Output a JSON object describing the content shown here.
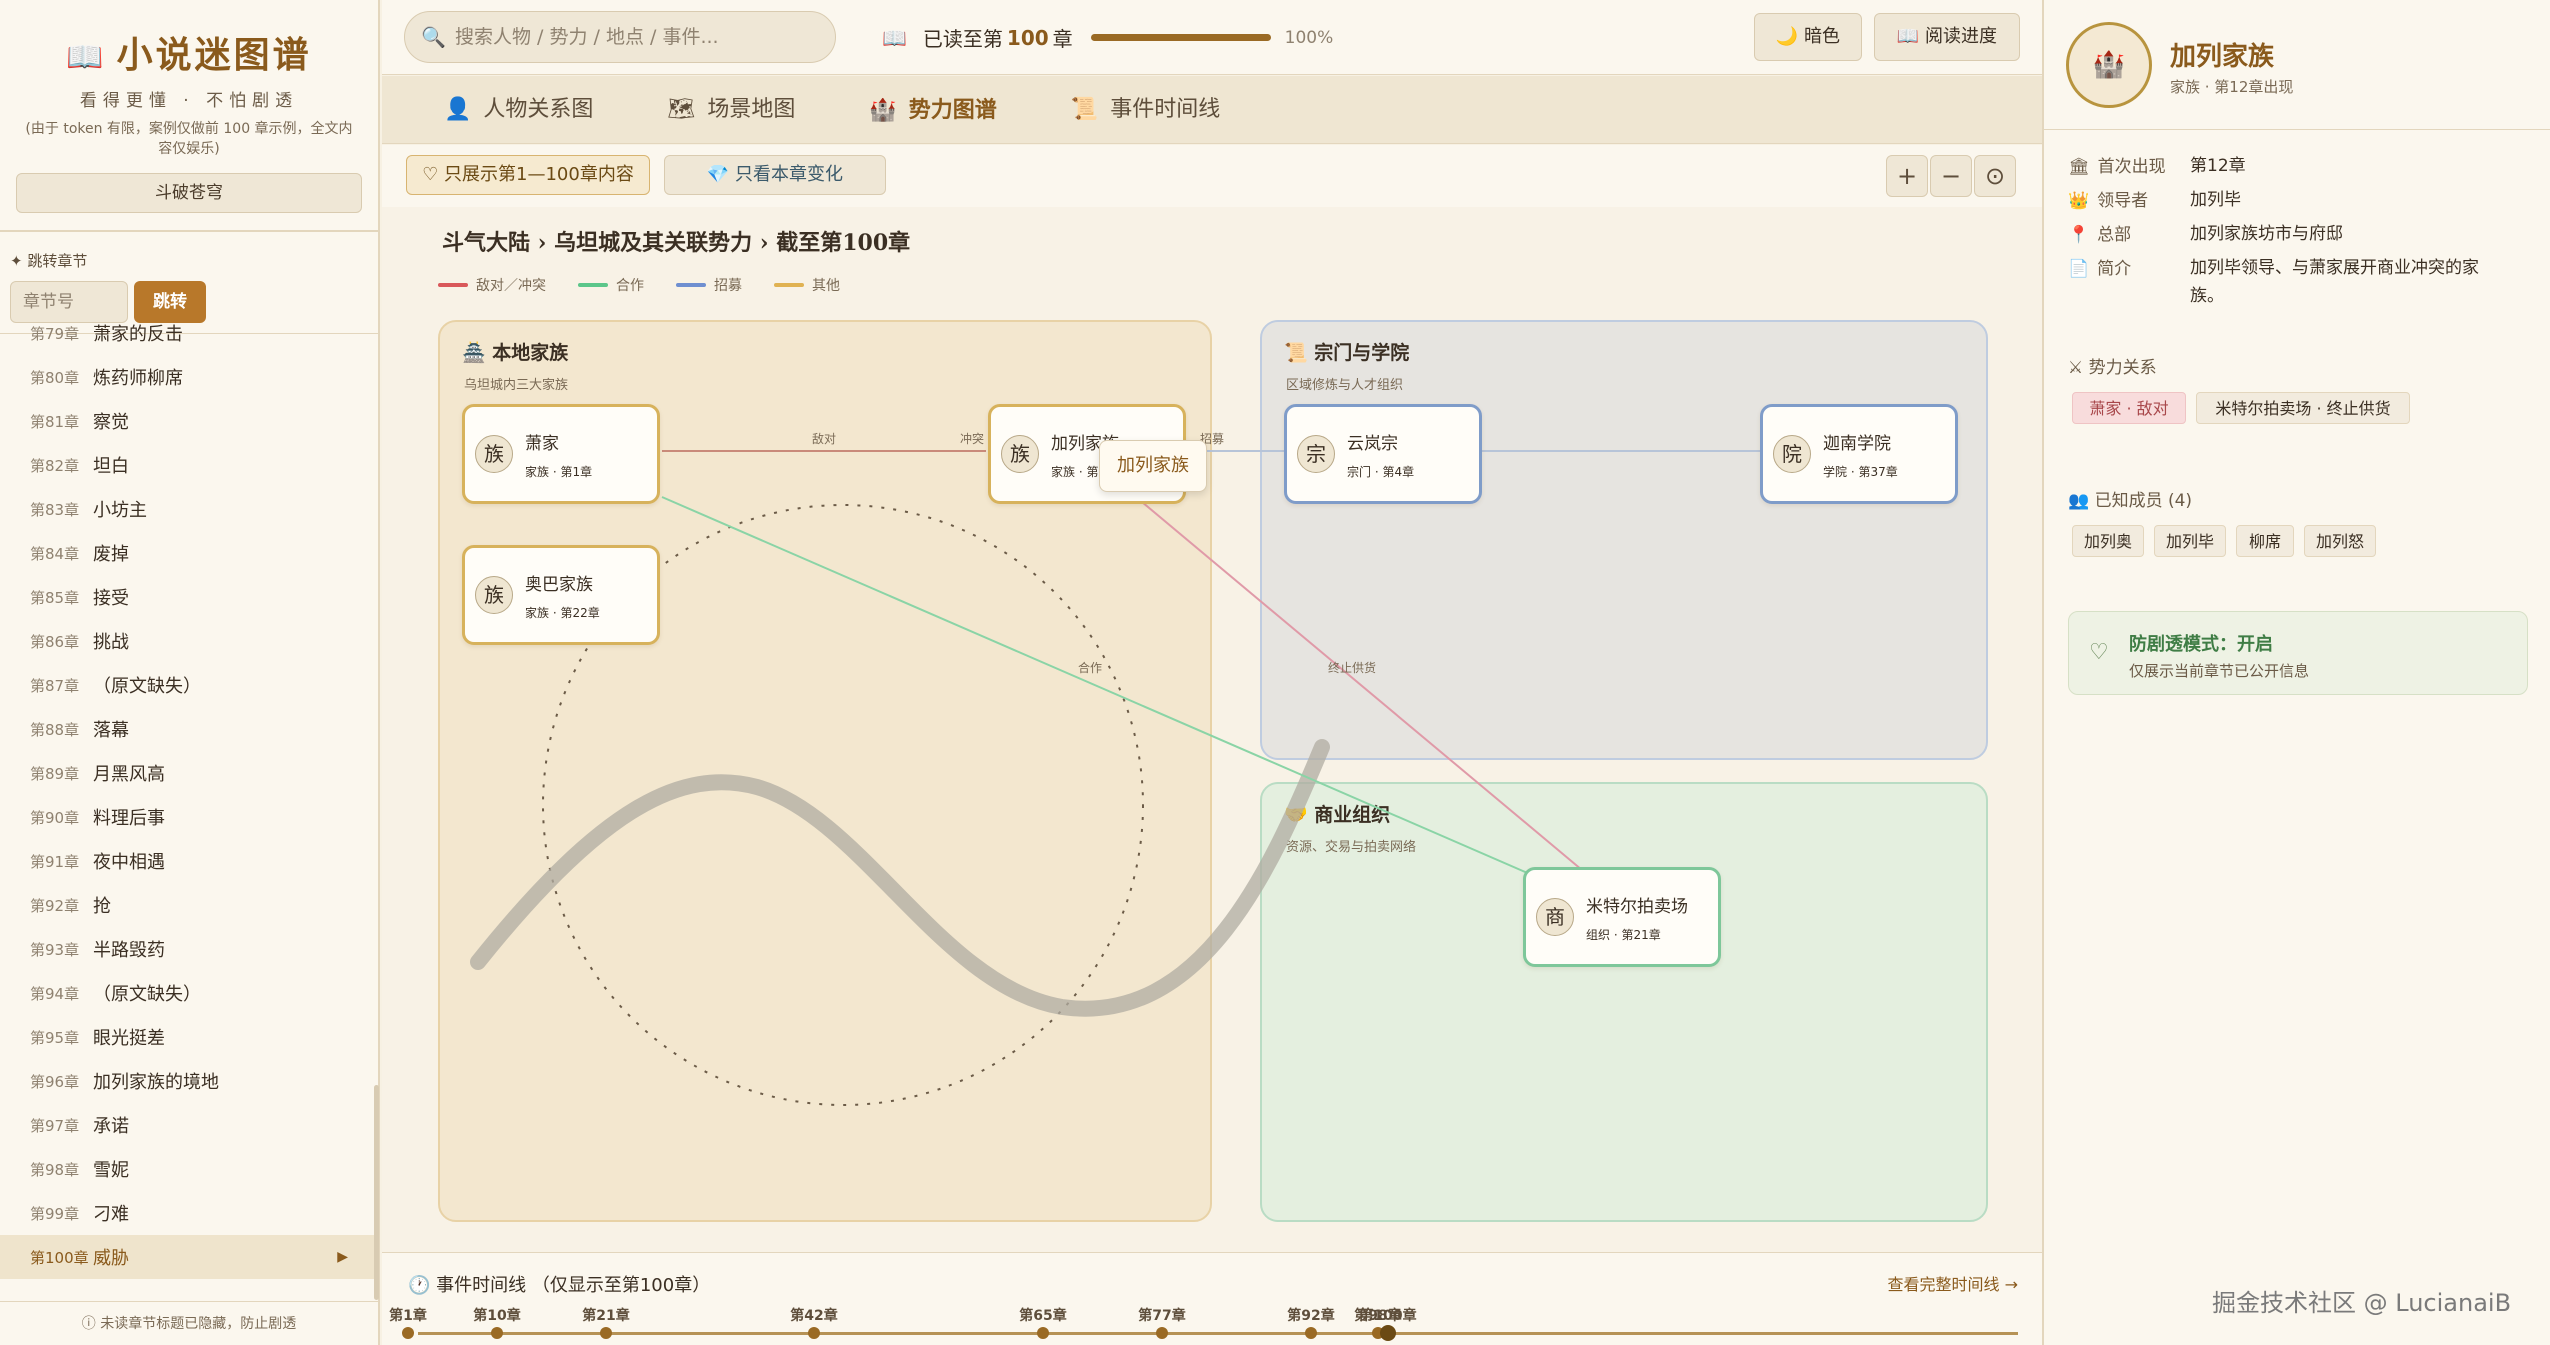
{
  "app": {
    "title": "小说迷图谱",
    "subtitle": "看得更懂 · 不怕剧透",
    "note": "(由于 token 有限，案例仅做前 100 章示例，全文内容仅娱乐)",
    "novel": "斗破苍穹"
  },
  "jump": {
    "label": "✦ 跳转章节",
    "placeholder": "章节号",
    "button": "跳转"
  },
  "chapters": [
    {
      "num": "第79章",
      "title": "萧家的反击"
    },
    {
      "num": "第80章",
      "title": "炼药师柳席"
    },
    {
      "num": "第81章",
      "title": "察觉"
    },
    {
      "num": "第82章",
      "title": "坦白"
    },
    {
      "num": "第83章",
      "title": "小坊主"
    },
    {
      "num": "第84章",
      "title": "废掉"
    },
    {
      "num": "第85章",
      "title": "接受"
    },
    {
      "num": "第86章",
      "title": "挑战"
    },
    {
      "num": "第87章",
      "title": "（原文缺失）"
    },
    {
      "num": "第88章",
      "title": "落幕"
    },
    {
      "num": "第89章",
      "title": "月黑风高"
    },
    {
      "num": "第90章",
      "title": "料理后事"
    },
    {
      "num": "第91章",
      "title": "夜中相遇"
    },
    {
      "num": "第92章",
      "title": "抢"
    },
    {
      "num": "第93章",
      "title": "半路毁药"
    },
    {
      "num": "第94章",
      "title": "（原文缺失）"
    },
    {
      "num": "第95章",
      "title": "眼光挺差"
    },
    {
      "num": "第96章",
      "title": "加列家族的境地"
    },
    {
      "num": "第97章",
      "title": "承诺"
    },
    {
      "num": "第98章",
      "title": "雪妮"
    },
    {
      "num": "第99章",
      "title": "刁难"
    },
    {
      "num": "第100章",
      "title": "威胁",
      "active": true
    }
  ],
  "sidebar_footer": "ⓘ 未读章节标题已隐藏，防止剧透",
  "search": {
    "placeholder": "搜索人物 / 势力 / 地点 / 事件..."
  },
  "progress": {
    "prefix": "已读至第",
    "chapter": "100",
    "suffix": "章",
    "percent_label": "100%",
    "fraction": 1.0
  },
  "toolbar": {
    "dark": "🌙 暗色",
    "reading": "📖 阅读进度"
  },
  "tabs": [
    {
      "icon": "👤",
      "label": "人物关系图"
    },
    {
      "icon": "🗺",
      "label": "场景地图"
    },
    {
      "icon": "🏰",
      "label": "势力图谱",
      "active": true
    },
    {
      "icon": "📜",
      "label": "事件时间线"
    }
  ],
  "filters": {
    "range": "♡ 只展示第1—100章内容",
    "changes": "💎 只看本章变化"
  },
  "zoom": {
    "in": "+",
    "out": "−",
    "reset": "⊙"
  },
  "graph": {
    "breadcrumb": "斗气大陆 › 乌坦城及其关联势力 › 截至第100章",
    "legend": [
      {
        "label": "敌对／冲突",
        "color": "#d9585a"
      },
      {
        "label": "合作",
        "color": "#5cc68a"
      },
      {
        "label": "招募",
        "color": "#6f8fd0"
      },
      {
        "label": "其他",
        "color": "#e0b252"
      }
    ],
    "groups": [
      {
        "icon": "🏯",
        "title": "本地家族",
        "sub": "乌坦城内三大家族"
      },
      {
        "icon": "📜",
        "title": "宗门与学院",
        "sub": "区域修炼与人才组织"
      },
      {
        "icon": "🤝",
        "title": "商业组织",
        "sub": "资源、交易与拍卖网络"
      }
    ],
    "nodes": [
      {
        "avatar": "族",
        "name": "萧家",
        "meta": "家族 · 第1章"
      },
      {
        "avatar": "族",
        "name": "加列家族",
        "meta": "家族 · 第12章"
      },
      {
        "avatar": "族",
        "name": "奥巴家族",
        "meta": "家族 · 第22章"
      },
      {
        "avatar": "宗",
        "name": "云岚宗",
        "meta": "宗门 · 第4章"
      },
      {
        "avatar": "院",
        "name": "迦南学院",
        "meta": "学院 · 第37章"
      },
      {
        "avatar": "商",
        "name": "米特尔拍卖场",
        "meta": "组织 · 第21章"
      }
    ],
    "edge_labels": [
      "敌对",
      "冲突",
      "招募",
      "合作",
      "终止供货"
    ],
    "tooltip": "加列家族"
  },
  "timeline": {
    "title": "🕐 事件时间线 （仅显示至第100章）",
    "more": "查看完整时间线 →",
    "marks": [
      "第1章",
      "第10章",
      "第21章",
      "第42章",
      "第65章",
      "第77章",
      "第92章",
      "第98章",
      "第100章"
    ]
  },
  "detail": {
    "avatar": "🏰",
    "name": "加列家族",
    "meta": "家族 · 第12章出现",
    "rows": [
      {
        "icon": "🏛",
        "key": "首次出现",
        "value": "第12章"
      },
      {
        "icon": "👑",
        "key": "领导者",
        "value": "加列毕"
      },
      {
        "icon": "📍",
        "key": "总部",
        "value": "加列家族坊市与府邸"
      },
      {
        "icon": "📄",
        "key": "简介",
        "value": "加列毕领导、与萧家展开商业冲突的家族。"
      }
    ],
    "relations_title": "⚔ 势力关系",
    "relations": [
      "萧家 · 敌对",
      "米特尔拍卖场 · 终止供货"
    ],
    "members_title": "👥 已知成员 (4)",
    "members": [
      "加列奥",
      "加列毕",
      "柳席",
      "加列怒"
    ],
    "spoiler_title": "防剧透模式：开启",
    "spoiler_desc": "仅展示当前章节已公开信息"
  },
  "watermark": "掘金技术社区 @ LucianaiB",
  "colors": {
    "accent": "#8a5a1c",
    "family_border": "#d7b25c",
    "sect_border": "#7f9cc9",
    "commerce_border": "#7ec79a"
  }
}
